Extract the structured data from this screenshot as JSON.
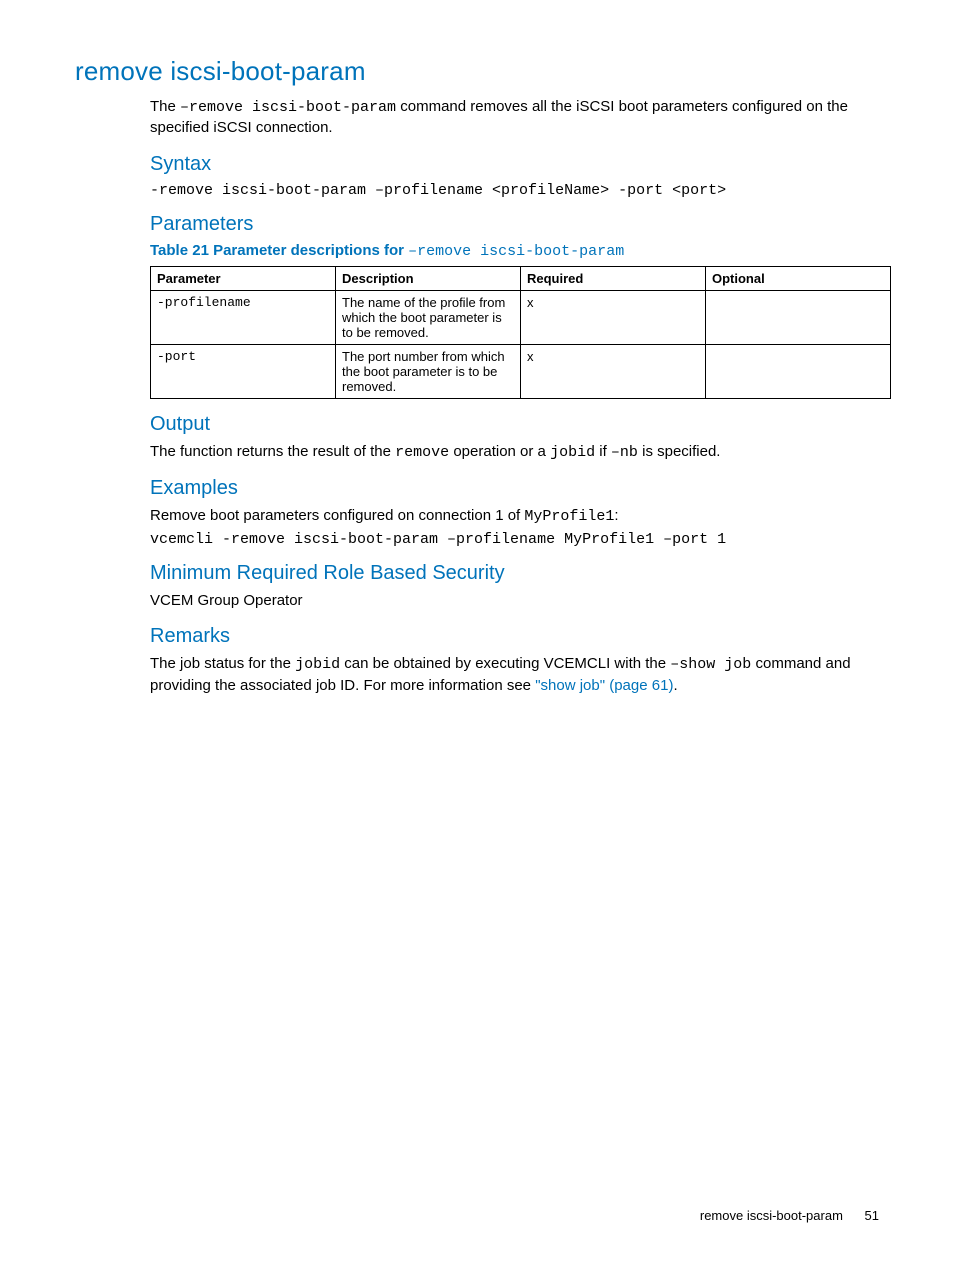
{
  "title": "remove iscsi-boot-param",
  "intro": {
    "pre": "The ",
    "cmd": "–remove iscsi-boot-param",
    "post": " command removes all the iSCSI boot parameters configured on the specified iSCSI connection."
  },
  "syntax": {
    "heading": "Syntax",
    "line": "-remove iscsi-boot-param –profilename <profileName> -port <port>"
  },
  "parameters": {
    "heading": "Parameters",
    "caption_bold": "Table 21 Parameter descriptions for ",
    "caption_mono": "–remove iscsi-boot-param",
    "headers": [
      "Parameter",
      "Description",
      "Required",
      "Optional"
    ],
    "rows": [
      {
        "param": "-profilename",
        "desc": "The name of the profile from which the boot parameter is to be removed.",
        "required": "x",
        "optional": ""
      },
      {
        "param": "-port",
        "desc": "The port number from which the boot parameter is to be removed.",
        "required": "x",
        "optional": ""
      }
    ]
  },
  "output": {
    "heading": "Output",
    "pre": "The function returns the result of the ",
    "code1": "remove",
    "mid": " operation or a ",
    "code2": "jobid",
    "mid2": " if ",
    "code3": "–nb",
    "post": " is specified."
  },
  "examples": {
    "heading": "Examples",
    "line1_pre": "Remove boot parameters configured on connection 1 of ",
    "line1_code": "MyProfile1",
    "line1_post": ":",
    "line2": "vcemcli -remove iscsi-boot-param –profilename MyProfile1 –port 1"
  },
  "security": {
    "heading": "Minimum Required Role Based Security",
    "text": "VCEM Group Operator"
  },
  "remarks": {
    "heading": "Remarks",
    "pre": "The job status for the ",
    "code1": "jobid",
    "mid1": " can be obtained by executing VCEMCLI with the ",
    "code2": "–show job",
    "mid2": " command and providing the associated job ID. For more information see ",
    "link": "\"show job\" (page 61)",
    "post": "."
  },
  "footer": {
    "text": "remove iscsi-boot-param",
    "page": "51"
  }
}
